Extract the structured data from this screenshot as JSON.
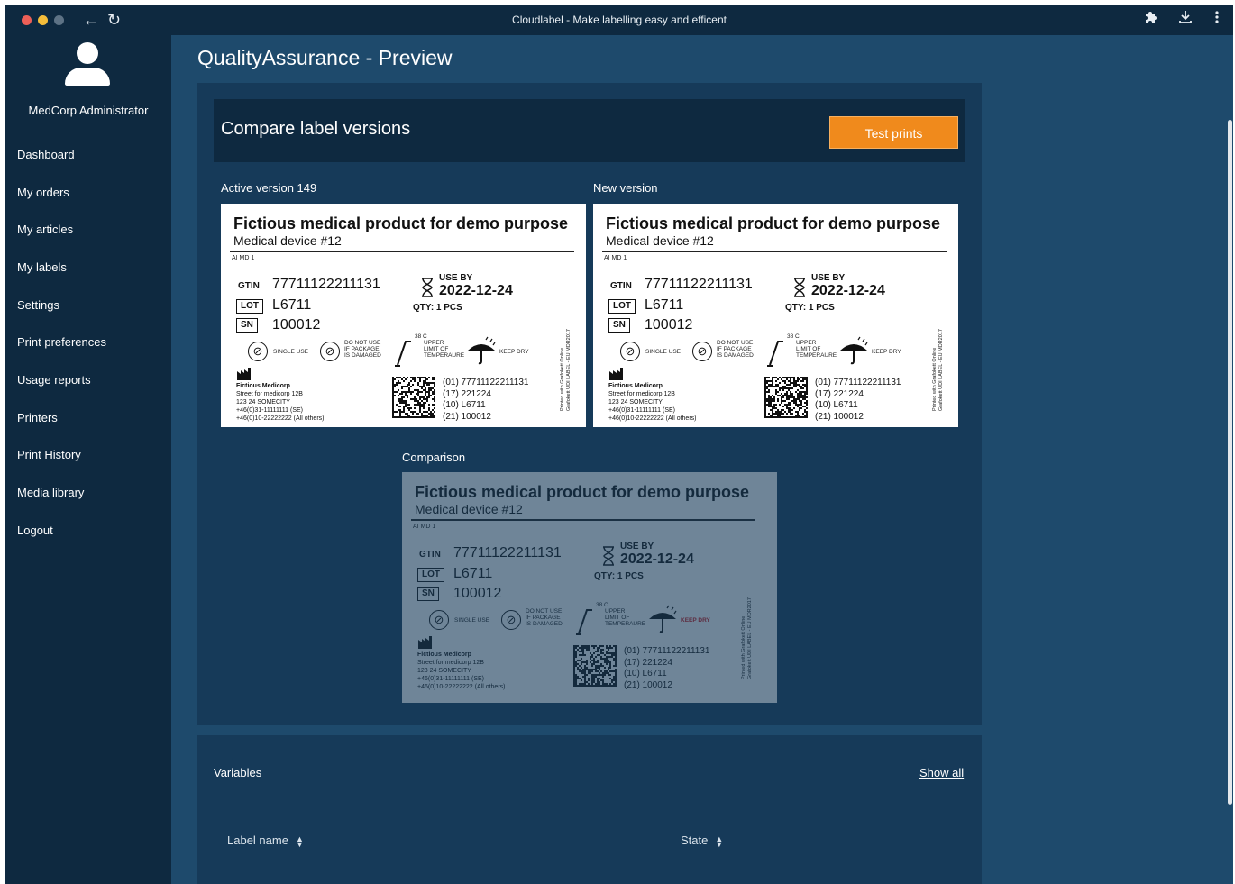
{
  "window": {
    "title": "Cloudlabel - Make labelling easy and efficent",
    "back_icon": "arrow-left-icon",
    "reload_icon": "reload-icon",
    "extensions_icon": "puzzle-icon",
    "download_icon": "download-icon",
    "menu_icon": "kebab-menu-icon"
  },
  "sidebar": {
    "user": "MedCorp Administrator",
    "items": [
      {
        "label": "Dashboard"
      },
      {
        "label": "My orders"
      },
      {
        "label": "My articles"
      },
      {
        "label": "My labels"
      },
      {
        "label": "Settings"
      },
      {
        "label": "Print preferences"
      },
      {
        "label": "Usage reports"
      },
      {
        "label": "Printers"
      },
      {
        "label": "Print History"
      },
      {
        "label": "Media library"
      },
      {
        "label": "Logout"
      }
    ]
  },
  "page": {
    "title": "QualityAssurance - Preview",
    "compare_title": "Compare label versions",
    "test_prints_label": "Test prints",
    "active_caption": "Active version 149",
    "new_caption": "New version",
    "comparison_caption": "Comparison",
    "accent_color": "#f08a1c"
  },
  "label": {
    "title": "Fictious medical product for demo purpose",
    "subtitle": "Medical device #12",
    "aimd": "AI MD 1",
    "gtin_key": "GTIN",
    "gtin": "77711122211131",
    "lot_key": "LOT",
    "lot": "L6711",
    "sn_key": "SN",
    "sn": "100012",
    "use_by_key": "USE BY",
    "use_by": "2022-12-24",
    "qty": "QTY: 1 PCS",
    "single_use": "SINGLE USE",
    "do_not_use": [
      "DO NOT USE",
      "IF PACKAGE",
      "IS DAMAGED"
    ],
    "temp_value": "38 C",
    "temp_label": [
      "UPPER",
      "LIMIT OF",
      "TEMPERAURE"
    ],
    "keep_dry": "KEEP DRY",
    "manufacturer": {
      "name": "Fictious Medicorp",
      "street": "Street for medicorp 12B",
      "city": "123 24 SOMECITY",
      "phone_se": "+46(0)31-11111111 (SE)",
      "phone_other": "+46(0)10-22222222 (All others)"
    },
    "udi": [
      "(01) 77711122211131",
      "(17) 221224",
      "(10) L6711",
      "(21) 100012"
    ],
    "printed_with": [
      "Printed with Grafokett Online",
      "Grafokett UDI LABEL - EU MDR2017"
    ]
  },
  "variables": {
    "title": "Variables",
    "show_all": "Show all",
    "columns": [
      {
        "label": "Label name"
      },
      {
        "label": "State"
      }
    ]
  }
}
